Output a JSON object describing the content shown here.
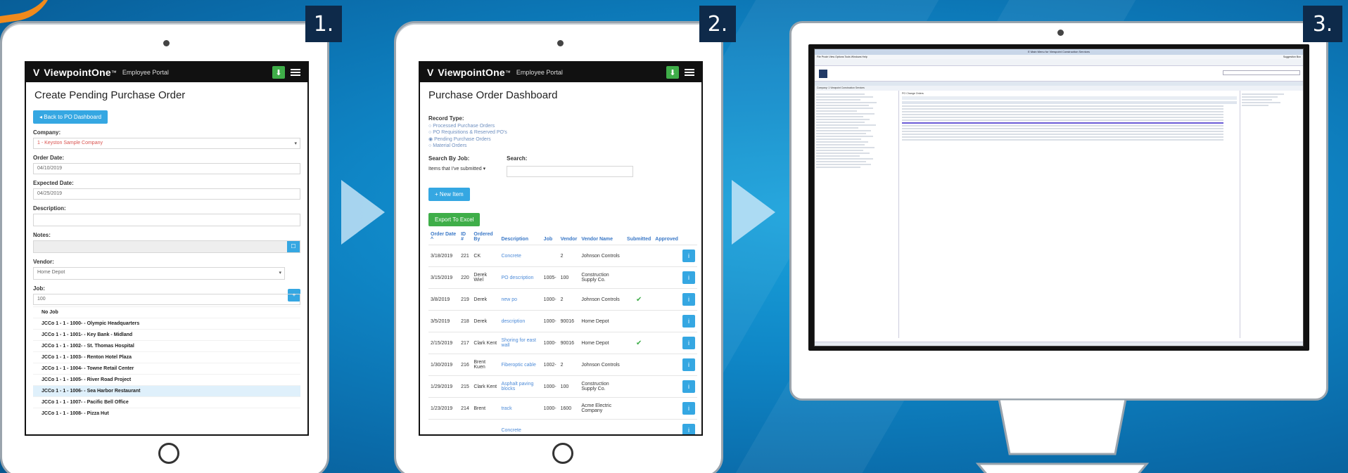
{
  "steps": [
    "1.",
    "2.",
    "3."
  ],
  "portal": {
    "brand": "ViewpointOne",
    "tm": "™",
    "subtitle": "Employee Portal",
    "download_icon": "download-icon"
  },
  "screen1": {
    "title": "Create Pending Purchase Order",
    "back_button": "Back to PO Dashboard",
    "company_label": "Company:",
    "company_value": "1 - Keyston Sample Company",
    "order_date_label": "Order Date:",
    "order_date_value": "04/10/2019",
    "expected_date_label": "Expected Date:",
    "expected_date_value": "04/25/2019",
    "description_label": "Description:",
    "notes_label": "Notes:",
    "vendor_label": "Vendor:",
    "vendor_value": "Home Depot",
    "job_label": "Job:",
    "job_value": "100",
    "job_options": [
      "No Job",
      "JCCo 1 - 1 - 1000- - Olympic Headquarters",
      "JCCo 1 - 1 - 1001- - Key Bank - Midland",
      "JCCo 1 - 1 - 1002- - St. Thomas Hospital",
      "JCCo 1 - 1 - 1003- - Renton Hotel Plaza",
      "JCCo 1 - 1 - 1004- - Towne Retail Center",
      "JCCo 1 - 1 - 1005- - River Road Project",
      "JCCo 1 - 1 - 1006- - Sea Harbor Restaurant",
      "JCCo 1 - 1 - 1007- - Pacific Bell Office",
      "JCCo 1 - 1 - 1008- - Pizza Hut"
    ]
  },
  "screen2": {
    "title": "Purchase Order Dashboard",
    "record_type_label": "Record Type:",
    "record_types": [
      "Processed Purchase Orders",
      "PO Requisitions & Reserved PO's",
      "Pending Purchase Orders",
      "Material Orders"
    ],
    "search_by_job_label": "Search By Job:",
    "search_label": "Search:",
    "job_filter_value": "Items that I've submitted",
    "new_item_button": "+ New Item",
    "export_button": "Export To Excel",
    "columns": [
      "Order Date ^",
      "ID #",
      "Ordered By",
      "Description",
      "Job",
      "Vendor",
      "Vendor Name",
      "Submitted",
      "Approved",
      ""
    ],
    "rows": [
      {
        "date": "3/18/2019",
        "id": "221",
        "by": "CK",
        "desc": "Concrete",
        "job": "",
        "vendor": "2",
        "vname": "Johnson Controls",
        "submitted": "",
        "approved": ""
      },
      {
        "date": "3/15/2019",
        "id": "220",
        "by": "Derek Wiel",
        "desc": "PO description",
        "job": "1005-",
        "vendor": "100",
        "vname": "Construction Supply Co.",
        "submitted": "",
        "approved": ""
      },
      {
        "date": "3/8/2019",
        "id": "219",
        "by": "Derek",
        "desc": "new po",
        "job": "1000-",
        "vendor": "2",
        "vname": "Johnson Controls",
        "submitted": "✔",
        "approved": ""
      },
      {
        "date": "3/5/2019",
        "id": "218",
        "by": "Derek",
        "desc": "description",
        "job": "1000-",
        "vendor": "90016",
        "vname": "Home Depot",
        "submitted": "",
        "approved": ""
      },
      {
        "date": "2/15/2019",
        "id": "217",
        "by": "Clark Kent",
        "desc": "Shoring for east wall",
        "job": "1000-",
        "vendor": "90016",
        "vname": "Home Depot",
        "submitted": "✔",
        "approved": ""
      },
      {
        "date": "1/30/2019",
        "id": "216",
        "by": "Brent Kuen",
        "desc": "Fiberoptic cable",
        "job": "1002-",
        "vendor": "2",
        "vname": "Johnson Controls",
        "submitted": "",
        "approved": ""
      },
      {
        "date": "1/29/2019",
        "id": "215",
        "by": "Clark Kent",
        "desc": "Asphalt paving blocks",
        "job": "1000-",
        "vendor": "100",
        "vname": "Construction Supply Co.",
        "submitted": "",
        "approved": ""
      },
      {
        "date": "1/23/2019",
        "id": "214",
        "by": "Brent",
        "desc": "track",
        "job": "1000-",
        "vendor": "1600",
        "vname": "Acme Electric Company",
        "submitted": "",
        "approved": ""
      },
      {
        "date": "",
        "id": "",
        "by": "",
        "desc": "Concrete",
        "job": "",
        "vendor": "",
        "vname": "",
        "submitted": "",
        "approved": ""
      }
    ]
  },
  "screen3": {
    "window_title": "E Main Menu for Viewpoint Construction Services",
    "menu": "File   Prodn   View   Options   Tools   Windows   Help",
    "suggestion": "Suggestion Box",
    "company_label": "Company:",
    "company_value": "1 Viewpoint Construction Services",
    "panel_title": "PO Change Orders"
  },
  "colors": {
    "accent_blue": "#35a7e2",
    "green": "#3fae49",
    "step_bg": "#0e2a4a",
    "link": "#4d8bd8"
  }
}
